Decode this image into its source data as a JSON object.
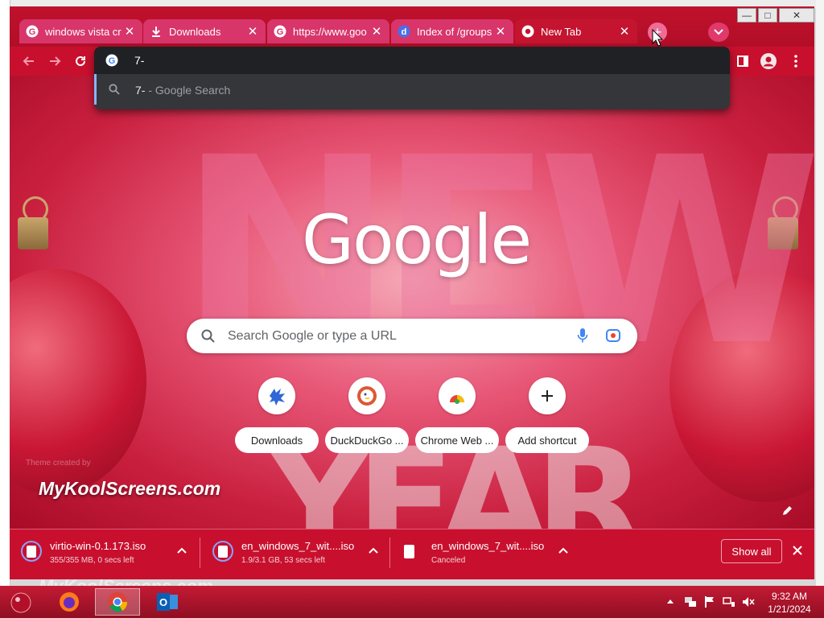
{
  "browser": {
    "tabs": [
      {
        "title": "windows vista cr",
        "icon": "google-g-icon",
        "active": false
      },
      {
        "title": "Downloads",
        "icon": "download-icon",
        "active": false
      },
      {
        "title": "https://www.goo",
        "icon": "google-g-icon",
        "active": false
      },
      {
        "title": "Index of /groups",
        "icon": "tab-favicon-icon",
        "active": false
      },
      {
        "title": "New Tab",
        "icon": "chrome-icon",
        "active": true
      }
    ],
    "new_tab_symbol": "+",
    "window_controls": {
      "minimize": "—",
      "maximize": "□",
      "close": "✕"
    }
  },
  "omnibox": {
    "typed": "7-",
    "suggestion_query": "7-",
    "suggestion_suffix": " - Google Search"
  },
  "ntp": {
    "logo": "Google",
    "search_placeholder": "Search Google or type a URL",
    "shortcuts": [
      {
        "label": "Downloads",
        "icon": "sonic-icon"
      },
      {
        "label": "DuckDuckGo ...",
        "icon": "duckduckgo-icon"
      },
      {
        "label": "Chrome Web ...",
        "icon": "chrome-web-store-icon"
      },
      {
        "label": "Add shortcut",
        "icon": "plus-icon"
      }
    ],
    "theme_credit": "Theme created by",
    "watermark": "MyKoolScreens.com"
  },
  "downloads": {
    "items": [
      {
        "name": "virtio-win-0.1.173.iso",
        "status": "355/355 MB, 0 secs left"
      },
      {
        "name": "en_windows_7_wit....iso",
        "status": "1.9/3.1 GB, 53 secs left"
      },
      {
        "name": "en_windows_7_wit....iso",
        "status": "Canceled"
      }
    ],
    "show_all": "Show all"
  },
  "taskbar": {
    "time": "9:32 AM",
    "date": "1/21/2024",
    "watermark": "MyKoolScreens.com"
  },
  "colors": {
    "theme": "#c8102e",
    "tab": "#d8356a",
    "omnibox": "#35363a",
    "accent_blue": "#8ab4f8"
  }
}
